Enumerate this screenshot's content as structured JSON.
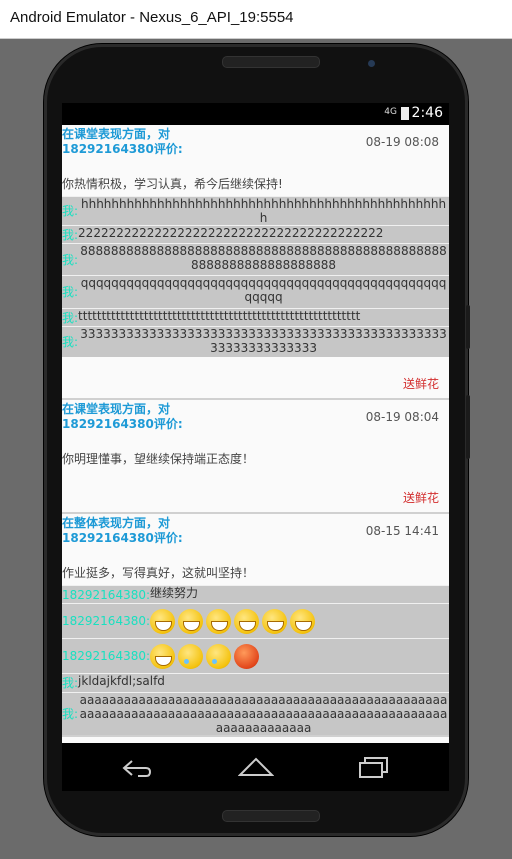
{
  "window": {
    "title": "Android Emulator - Nexus_6_API_19:5554"
  },
  "status": {
    "signal": "4G",
    "time": "2:46"
  },
  "cards": [
    {
      "type": "在课堂表现方面，对18292164380评价:",
      "date": "08-19 08:08",
      "text": "你热情积极，学习认真，希今后继续保持!",
      "replies": [
        {
          "who": "我:",
          "text": "hhhhhhhhhhhhhhhhhhhhhhhhhhhhhhhhhhhhhhhhhhhhhhhhh"
        },
        {
          "who": "我:",
          "text": "2222222222222222222222222222222222222222"
        },
        {
          "who": "我:",
          "text": "8888888888888888888888888888888888888888888888888888888888888888888"
        },
        {
          "who": "我:",
          "text": "qqqqqqqqqqqqqqqqqqqqqqqqqqqqqqqqqqqqqqqqqqqqqqqqqqqqq"
        },
        {
          "who": "我:",
          "text": "tttttttttttttttttttttttttttttttttttttttttttttttttttttttttttt"
        },
        {
          "who": "我:",
          "text": "33333333333333333333333333333333333333333333333333333333333333"
        }
      ],
      "action": "送鲜花"
    },
    {
      "type": "在课堂表现方面，对18292164380评价:",
      "date": "08-19 08:04",
      "text": "你明理懂事，望继续保持端正态度！",
      "replies": [],
      "action": "送鲜花"
    },
    {
      "type": "在整体表现方面，对18292164380评价:",
      "date": "08-15 14:41",
      "text": "作业挺多，写得真好，这就叫坚持！",
      "replies": [
        {
          "who": "18292164380:",
          "text": "继续努力"
        },
        {
          "who": "18292164380:",
          "emojis": [
            "laugh-emoji",
            "laugh-emoji",
            "laugh-emoji",
            "laugh-emoji",
            "laugh-emoji",
            "laugh-emoji"
          ]
        },
        {
          "who": "18292164380:",
          "emojis": [
            "laugh-emoji",
            "cry-emoji",
            "cry-emoji",
            "angry-emoji"
          ]
        },
        {
          "who": "我:",
          "text": "jkldajkfdl;salfd"
        },
        {
          "who": "我:",
          "text": "aaaaaaaaaaaaaaaaaaaaaaaaaaaaaaaaaaaaaaaaaaaaaaaaaaaaaaaaaaaaaaaaaaaaaaaaaaaaaaaaaaaaaaaaaaaaaaaaaaaaaaaaaaaaaaaaa"
        }
      ]
    }
  ],
  "navbar": {
    "back": "back-icon",
    "home": "home-icon",
    "recents": "recents-icon"
  }
}
